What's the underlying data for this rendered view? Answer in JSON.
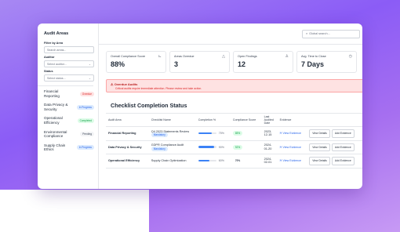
{
  "sidebar": {
    "title": "Audit Areas",
    "filter_area_label": "Filter by Area",
    "search_placeholder": "Search areas...",
    "auditor_label": "Auditor",
    "auditor_value": "Select auditor...",
    "status_label": "Status",
    "status_value": "Select status...",
    "areas": [
      {
        "name": "Financial Reporting",
        "status": "Overdue"
      },
      {
        "name": "Data Privacy & Security",
        "status": "In Progress"
      },
      {
        "name": "Operational Efficiency",
        "status": "Completed"
      },
      {
        "name": "Environmental Compliance",
        "status": "Pending"
      },
      {
        "name": "Supply Chain Ethics",
        "status": "In Progress"
      }
    ]
  },
  "topbar": {
    "search_placeholder": "Global search..."
  },
  "cards": [
    {
      "label": "Overall Compliance Score",
      "value": "88%",
      "icon": "chart-icon"
    },
    {
      "label": "Areas Overdue",
      "value": "3",
      "icon": "warning-icon"
    },
    {
      "label": "Open Findings",
      "value": "12",
      "icon": "flask-icon"
    },
    {
      "label": "Avg. Time to Close",
      "value": "7 Days",
      "icon": "clock-icon"
    }
  ],
  "alert": {
    "title": "Overdue Audits",
    "detail": "Critical audits require immediate attention. Please review and take action."
  },
  "table": {
    "title": "Checklist Completion Status",
    "headers": [
      "Audit Area",
      "Checklist Name",
      "Completion %",
      "Compliance Score",
      "Last Audited Date",
      "Evidence"
    ],
    "rows": [
      {
        "area": "Financial Reporting",
        "checklist": "Q4 2023 Statements Review",
        "tag": "Mandatory",
        "completion": "75%",
        "completion_value": 0.75,
        "score": "85%",
        "date": "2023-12-15"
      },
      {
        "area": "Data Privacy & Security",
        "checklist": "GDPR Compliance Audit",
        "tag": "Mandatory",
        "completion": "90%",
        "completion_value": 0.9,
        "score": "92%",
        "date": "2024-01-20"
      },
      {
        "area": "Operational Efficiency",
        "checklist": "Supply Chain Optimization",
        "tag": "",
        "completion": "60%",
        "completion_value": 0.6,
        "score": "70%",
        "date": "2024-02-01"
      }
    ],
    "view_evidence_label": "View Evidence",
    "view_details_label": "View Details",
    "add_evidence_label": "Add Evidence"
  },
  "colors": {
    "accent": "#3b82f6",
    "background": "#8b5cf6",
    "alert": "#dc2626"
  }
}
